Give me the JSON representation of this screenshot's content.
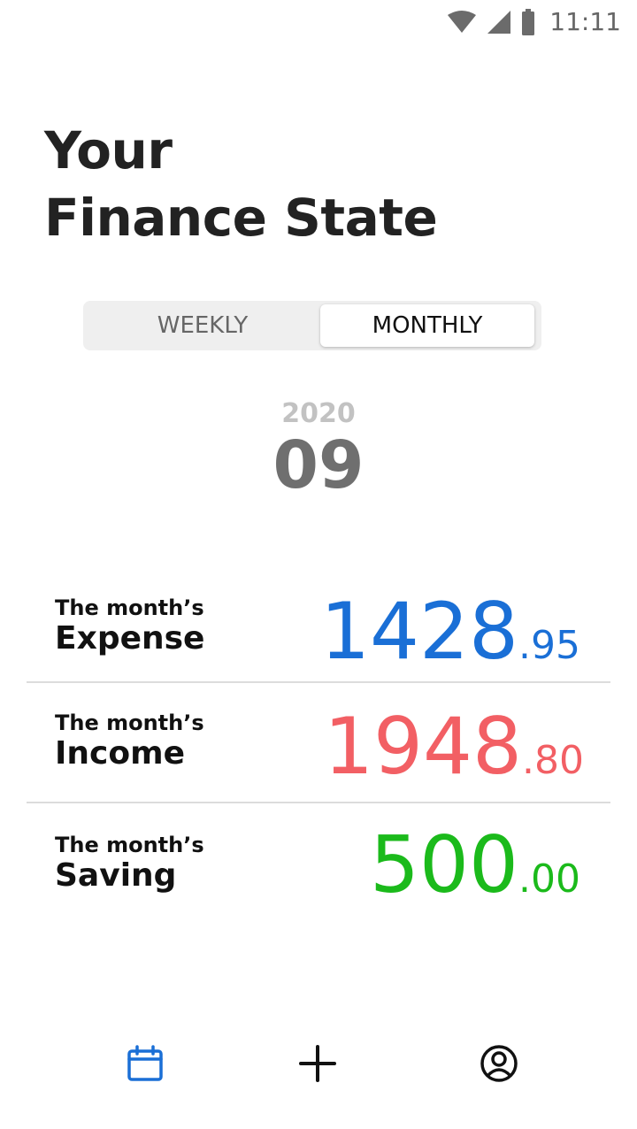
{
  "status": {
    "time": "11:11"
  },
  "header": {
    "line1": "Your",
    "line2": "Finance State"
  },
  "toggle": {
    "weekly": "WEEKLY",
    "monthly": "MONTHLY",
    "selected": "MONTHLY"
  },
  "period": {
    "year": "2020",
    "month": "09"
  },
  "rows": [
    {
      "caption": "The month’s",
      "label": "Expense",
      "int": "1428",
      "dec": ".95",
      "color": "#1a6fd6"
    },
    {
      "caption": "The month’s",
      "label": "Income",
      "int": "1948",
      "dec": ".80",
      "color": "#f25f64"
    },
    {
      "caption": "The month’s",
      "label": "Saving",
      "int": "500",
      "dec": ".00",
      "color": "#1bba1b"
    }
  ],
  "nav": {
    "items": [
      "calendar-icon",
      "plus-icon",
      "account-icon"
    ],
    "active_color": "#1a6fd6",
    "icon_color": "#111111"
  }
}
